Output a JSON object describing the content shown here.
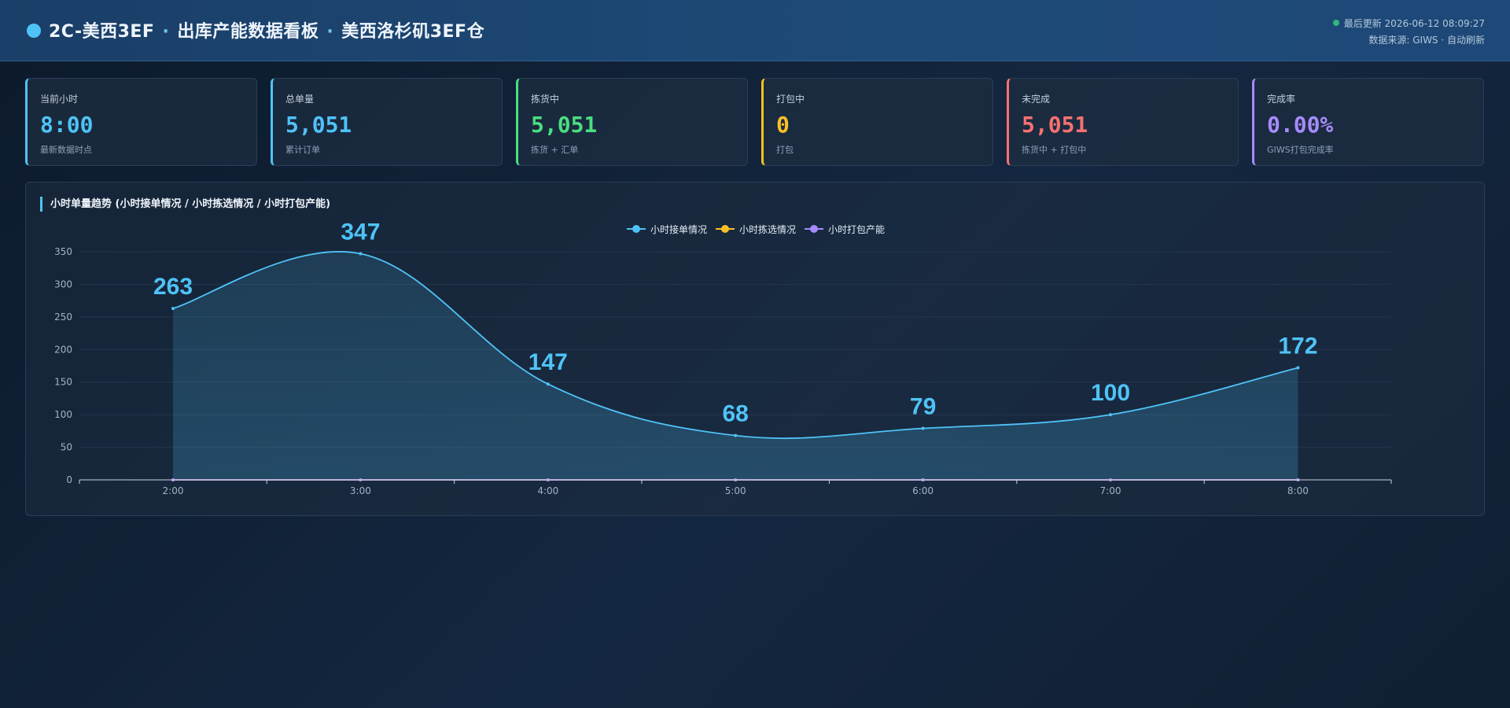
{
  "header": {
    "title_part1": "2C-美西3EF",
    "separator": "·",
    "title_part2": "出库产能数据看板",
    "title_part3": "美西洛杉矶3EF仓",
    "last_update_label": "最后更新",
    "last_update_time": "2026-06-12 08:09:27",
    "source_text": "数据来源: GIWS · 自动刷新",
    "live_color": "#2fb87a"
  },
  "kpis": [
    {
      "label": "当前小时",
      "value": "8:00",
      "sub": "最新数据时点",
      "color": "#4fc3f7"
    },
    {
      "label": "总单量",
      "value": "5,051",
      "sub": "累计订单",
      "color": "#4fc3f7"
    },
    {
      "label": "拣货中",
      "value": "5,051",
      "sub": "拣货 + 汇单",
      "color": "#4ade80"
    },
    {
      "label": "打包中",
      "value": "0",
      "sub": "打包",
      "color": "#fbbf24"
    },
    {
      "label": "未完成",
      "value": "5,051",
      "sub": "拣货中 + 打包中",
      "color": "#f87171"
    },
    {
      "label": "完成率",
      "value": "0.00%",
      "sub": "GIWS打包完成率",
      "color": "#a78bfa"
    }
  ],
  "chart_panel": {
    "title": "小时单量趋势 (小时接单情况 / 小时拣选情况 / 小时打包产能)"
  },
  "chart_data": {
    "type": "line",
    "title": "小时单量趋势 (小时接单情况 / 小时拣选情况 / 小时打包产能)",
    "categories": [
      "2:00",
      "3:00",
      "4:00",
      "5:00",
      "6:00",
      "7:00",
      "8:00"
    ],
    "series": [
      {
        "name": "小时接单情况",
        "color": "#4fc3f7",
        "values": [
          263,
          347,
          147,
          68,
          79,
          100,
          172
        ],
        "show_labels": true,
        "area": true
      },
      {
        "name": "小时拣选情况",
        "color": "#fbbf24",
        "values": [
          0,
          0,
          0,
          0,
          0,
          0,
          0
        ],
        "show_labels": false,
        "area": false
      },
      {
        "name": "小时打包产能",
        "color": "#a78bfa",
        "values": [
          0,
          0,
          0,
          0,
          0,
          0,
          0
        ],
        "show_labels": false,
        "area": false
      }
    ],
    "ylim": [
      0,
      350
    ],
    "yticks": [
      0,
      50,
      100,
      150,
      200,
      250,
      300,
      350
    ],
    "grid": true,
    "legend": "top-center"
  }
}
